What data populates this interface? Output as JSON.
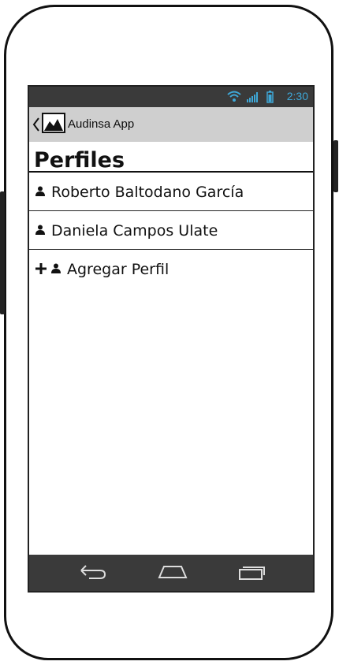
{
  "status_bar": {
    "time": "2:30",
    "icons": [
      "wifi-icon",
      "signal-icon",
      "battery-icon"
    ],
    "time_color": "#3ea8d8"
  },
  "action_bar": {
    "title": "Audinsa App",
    "back_icon": "chevron-left-icon",
    "app_icon": "image-icon"
  },
  "page": {
    "title": "Perfiles"
  },
  "profiles": [
    {
      "name": "Roberto Baltodano García",
      "icon": "user-icon"
    },
    {
      "name": "Daniela Campos Ulate",
      "icon": "user-icon"
    }
  ],
  "add_profile": {
    "label": "Agregar Perfil",
    "icons": [
      "plus-icon",
      "user-icon"
    ]
  },
  "nav_bar": {
    "buttons": [
      "back-nav-icon",
      "home-nav-icon",
      "recents-nav-icon"
    ]
  }
}
